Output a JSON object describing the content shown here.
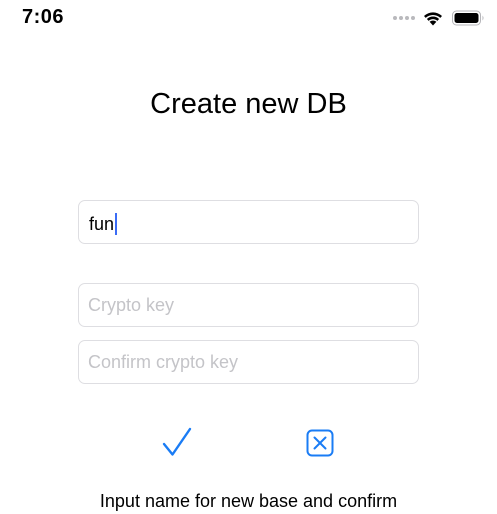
{
  "status_bar": {
    "time": "7:06",
    "icons": [
      "signal-dots-icon",
      "wifi-icon",
      "battery-icon"
    ]
  },
  "title": "Create new DB",
  "form": {
    "name_value": "fun",
    "crypto_key_placeholder": "Crypto key",
    "confirm_key_placeholder": "Confirm crypto key"
  },
  "actions": {
    "confirm_icon": "checkmark-icon",
    "cancel_icon": "close-square-icon"
  },
  "hint": "Input name for new base and confirm",
  "colors": {
    "accent": "#1a7cf5",
    "caret": "#3b6cf5",
    "placeholder": "#c4c4c8",
    "field_border": "#dedee2"
  }
}
